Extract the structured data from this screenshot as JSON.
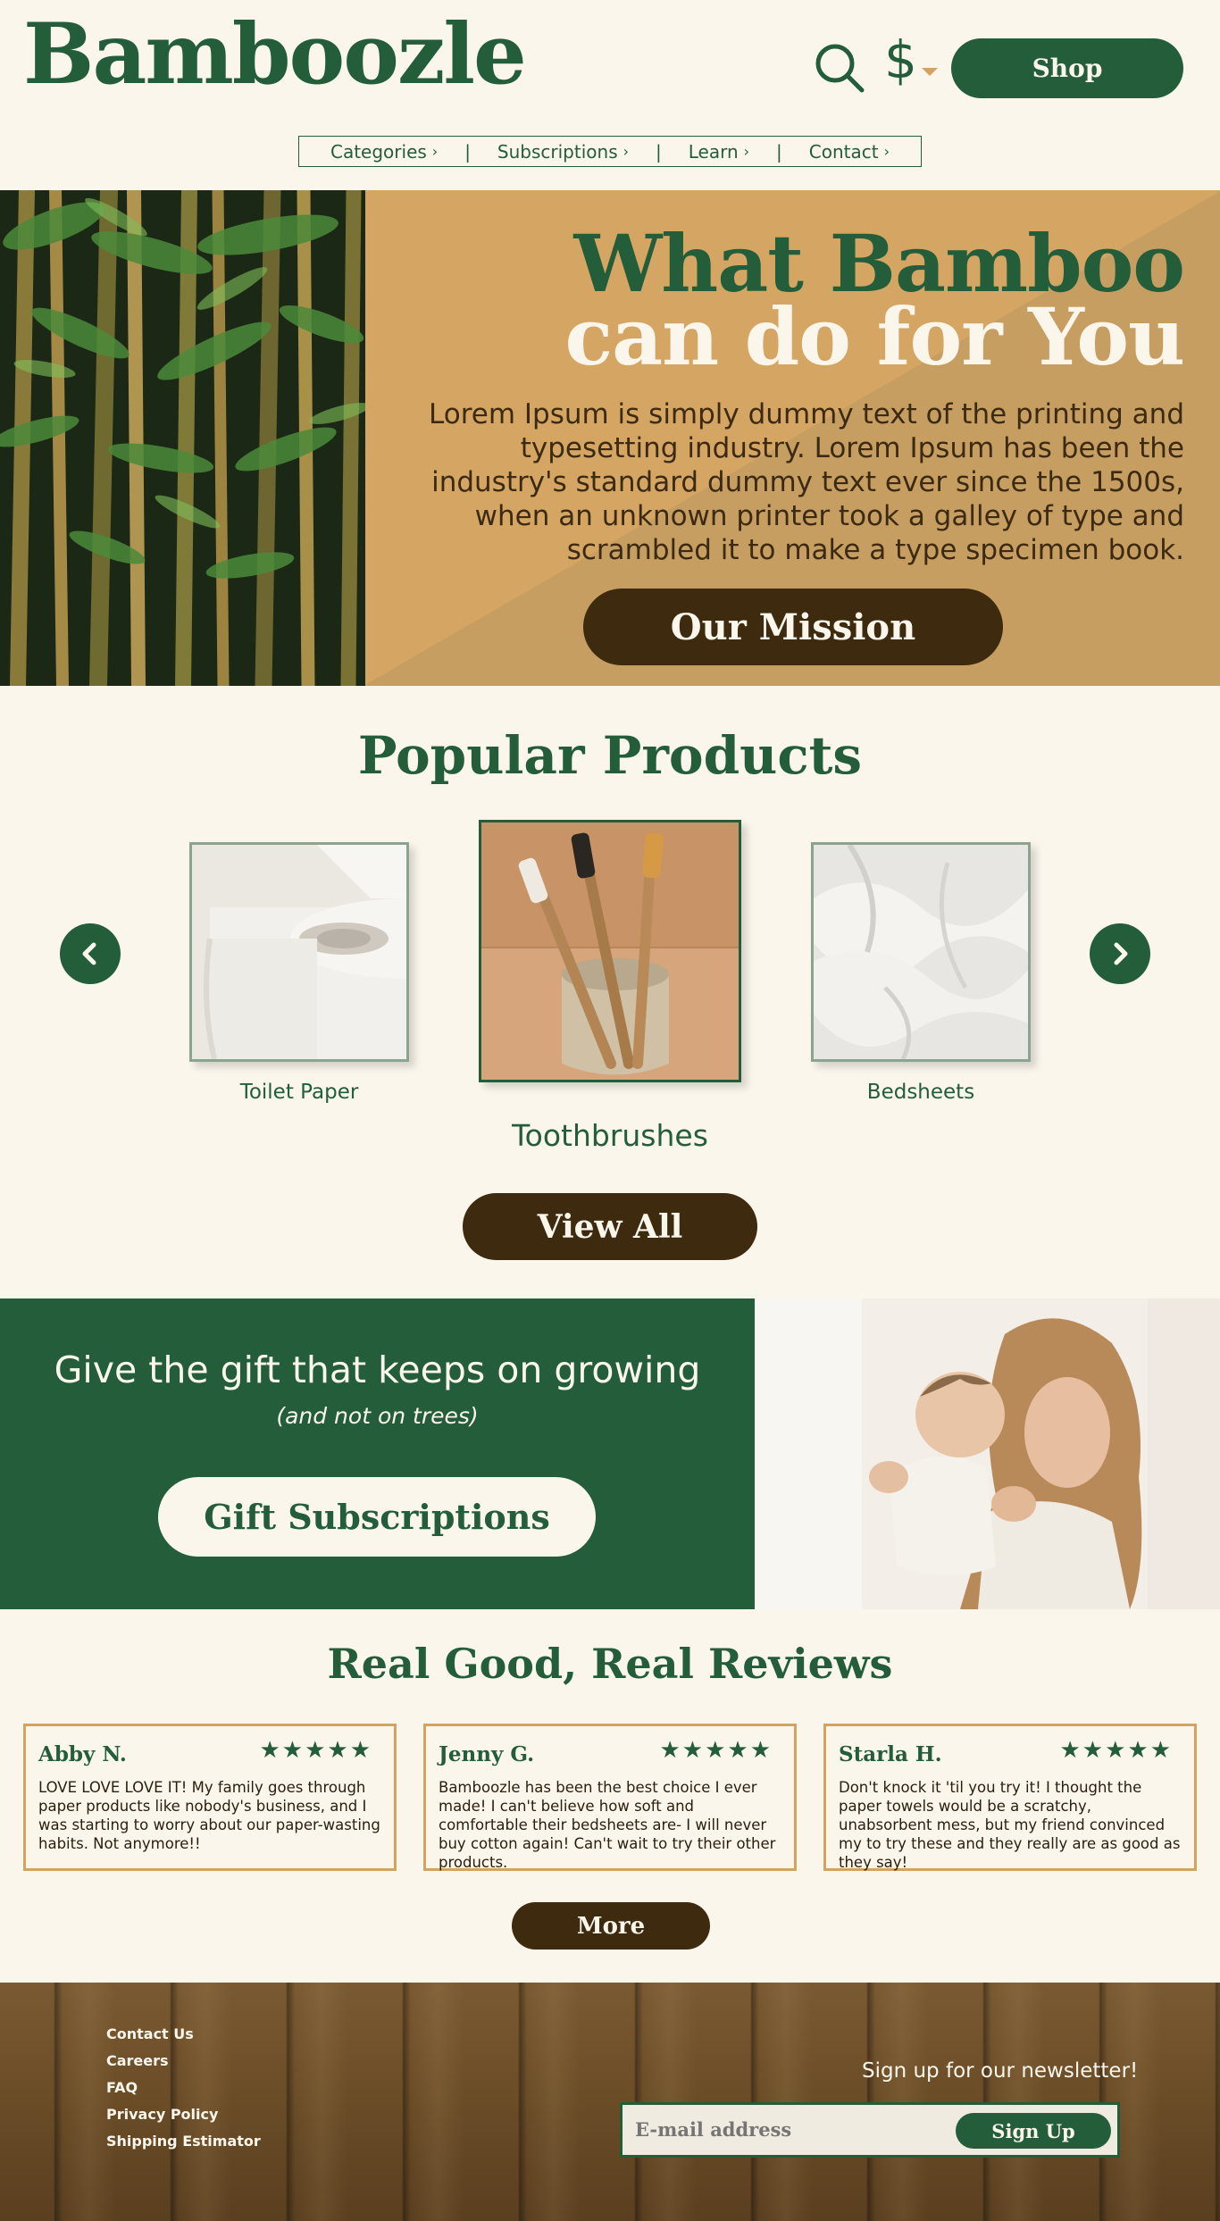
{
  "header": {
    "logo": "Bamboozle",
    "currency_symbol": "$",
    "shop_label": "Shop",
    "nav": [
      {
        "label": "Categories"
      },
      {
        "label": "Subscriptions"
      },
      {
        "label": "Learn"
      },
      {
        "label": "Contact"
      }
    ],
    "nav_separator": "|",
    "nav_chevron": "›"
  },
  "hero": {
    "title_line1": "What Bamboo",
    "title_line2": "can do for You",
    "body": "Lorem Ipsum is simply dummy text of the printing and typesetting industry. Lorem Ipsum  has been the industry's standard dummy text  ever since the 1500s, when an unknown printer took a galley of type and scrambled it to make a type specimen book.",
    "button_label": "Our Mission"
  },
  "products": {
    "title": "Popular Products",
    "items": [
      {
        "label": "Toilet Paper"
      },
      {
        "label": "Toothbrushes"
      },
      {
        "label": "Bedsheets"
      }
    ],
    "view_all_label": "View All"
  },
  "gift": {
    "title": "Give the gift that keeps on growing",
    "subtitle": "(and not on trees)",
    "button_label": "Gift Subscriptions"
  },
  "reviews": {
    "title": "Real Good, Real Reviews",
    "items": [
      {
        "name": "Abby N.",
        "stars": "★★★★★",
        "text": "LOVE LOVE LOVE IT! My family goes through paper products like nobody's business, and I was starting to worry about our paper-wasting habits. Not anymore!!"
      },
      {
        "name": "Jenny G.",
        "stars": "★★★★★",
        "text": "Bamboozle has been the best choice I ever made! I can't believe how soft and comfortable their bedsheets are- I will never buy cotton again! Can't wait to try their other products."
      },
      {
        "name": "Starla H.",
        "stars": "★★★★★",
        "text": "Don't knock it 'til you try it! I thought the paper towels would be a scratchy, unabsorbent mess, but my friend convinced my to try these and they really are as good as they say!"
      }
    ],
    "more_label": "More"
  },
  "footer": {
    "links": [
      {
        "label": "Contact Us"
      },
      {
        "label": "Careers"
      },
      {
        "label": "FAQ"
      },
      {
        "label": "Privacy Policy"
      },
      {
        "label": "Shipping Estimator"
      }
    ],
    "newsletter_label": "Sign up for our newsletter!",
    "email_placeholder": "E-mail address",
    "signup_label": "Sign Up"
  },
  "colors": {
    "brand_green": "#235d3a",
    "cream": "#faf6ec",
    "tan": "#d4a563",
    "dark_brown": "#3d2a0f"
  }
}
